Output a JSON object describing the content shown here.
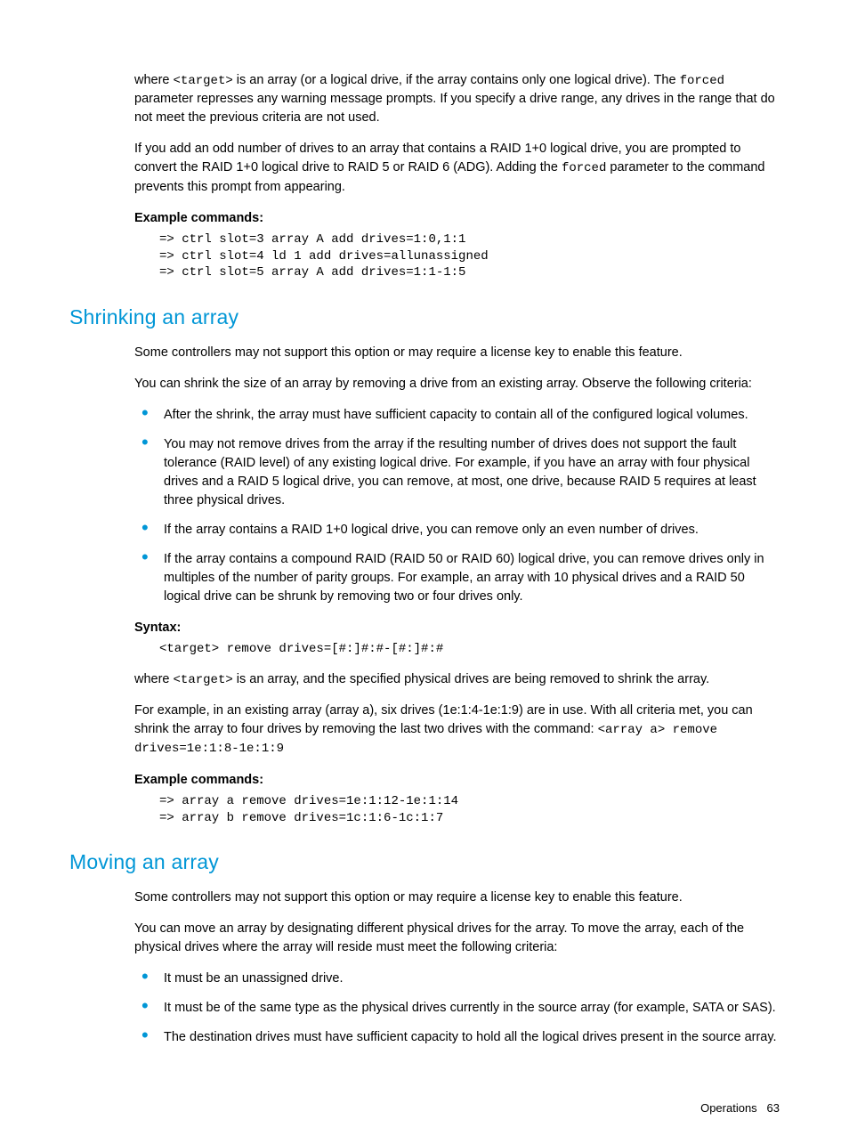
{
  "intro": {
    "p1_pre": "where ",
    "p1_code1": "<target>",
    "p1_mid": " is an array (or a logical drive, if the array contains only one logical drive). The ",
    "p1_code2": "forced",
    "p1_post": " parameter represses any warning message prompts. If you specify a drive range, any drives in the range that do not meet the previous criteria are not used.",
    "p2_pre": "If you add an odd number of drives to an array that contains a RAID 1+0 logical drive, you are prompted to convert the RAID 1+0 logical drive to RAID 5 or RAID 6 (ADG). Adding the ",
    "p2_code": "forced",
    "p2_post": " parameter to the command prevents this prompt from appearing.",
    "example_label": "Example commands:",
    "example_code": "=> ctrl slot=3 array A add drives=1:0,1:1\n=> ctrl slot=4 ld 1 add drives=allunassigned\n=> ctrl slot=5 array A add drives=1:1-1:5"
  },
  "shrink": {
    "heading": "Shrinking an array",
    "p1": "Some controllers may not support this option or may require a license key to enable this feature.",
    "p2": "You can shrink the size of an array by removing a drive from an existing array. Observe the following criteria:",
    "bullets": [
      "After the shrink, the array must have sufficient capacity to contain all of the configured logical volumes.",
      "You may not remove drives from the array if the resulting number of drives does not support the fault tolerance (RAID level) of any existing logical drive. For example, if you have an array with four physical drives and a RAID 5 logical drive, you can remove, at most, one drive, because RAID 5 requires at least three physical drives.",
      "If the array contains a RAID 1+0 logical drive, you can remove only an even number of drives.",
      "If the array contains a compound RAID (RAID 50 or RAID 60) logical drive, you can remove drives only in multiples of the number of parity groups. For example, an array with 10 physical drives and a RAID 50 logical drive can be shrunk by removing two or four drives only."
    ],
    "syntax_label": "Syntax:",
    "syntax_code": "<target> remove drives=[#:]#:#-[#:]#:#",
    "p3_pre": "where ",
    "p3_code": "<target>",
    "p3_post": " is an array, and the specified physical drives are being removed to shrink the array.",
    "p4_pre": "For example, in an existing array (array a), six drives (1e:1:4-1e:1:9) are in use. With all criteria met, you can shrink the array to four drives by removing the last two drives with the command: ",
    "p4_code": "<array a> remove drives=1e:1:8-1e:1:9",
    "example_label": "Example commands:",
    "example_code": "=> array a remove drives=1e:1:12-1e:1:14\n=> array b remove drives=1c:1:6-1c:1:7"
  },
  "move": {
    "heading": "Moving an array",
    "p1": "Some controllers may not support this option or may require a license key to enable this feature.",
    "p2": "You can move an array by designating different physical drives for the array. To move the array, each of the physical drives where the array will reside must meet the following criteria:",
    "bullets": [
      "It must be an unassigned drive.",
      "It must be of the same type as the physical drives currently in the source array (for example, SATA or SAS).",
      "The destination drives must have sufficient capacity to hold all the logical drives present in the source array."
    ]
  },
  "footer": {
    "section": "Operations",
    "page": "63"
  }
}
